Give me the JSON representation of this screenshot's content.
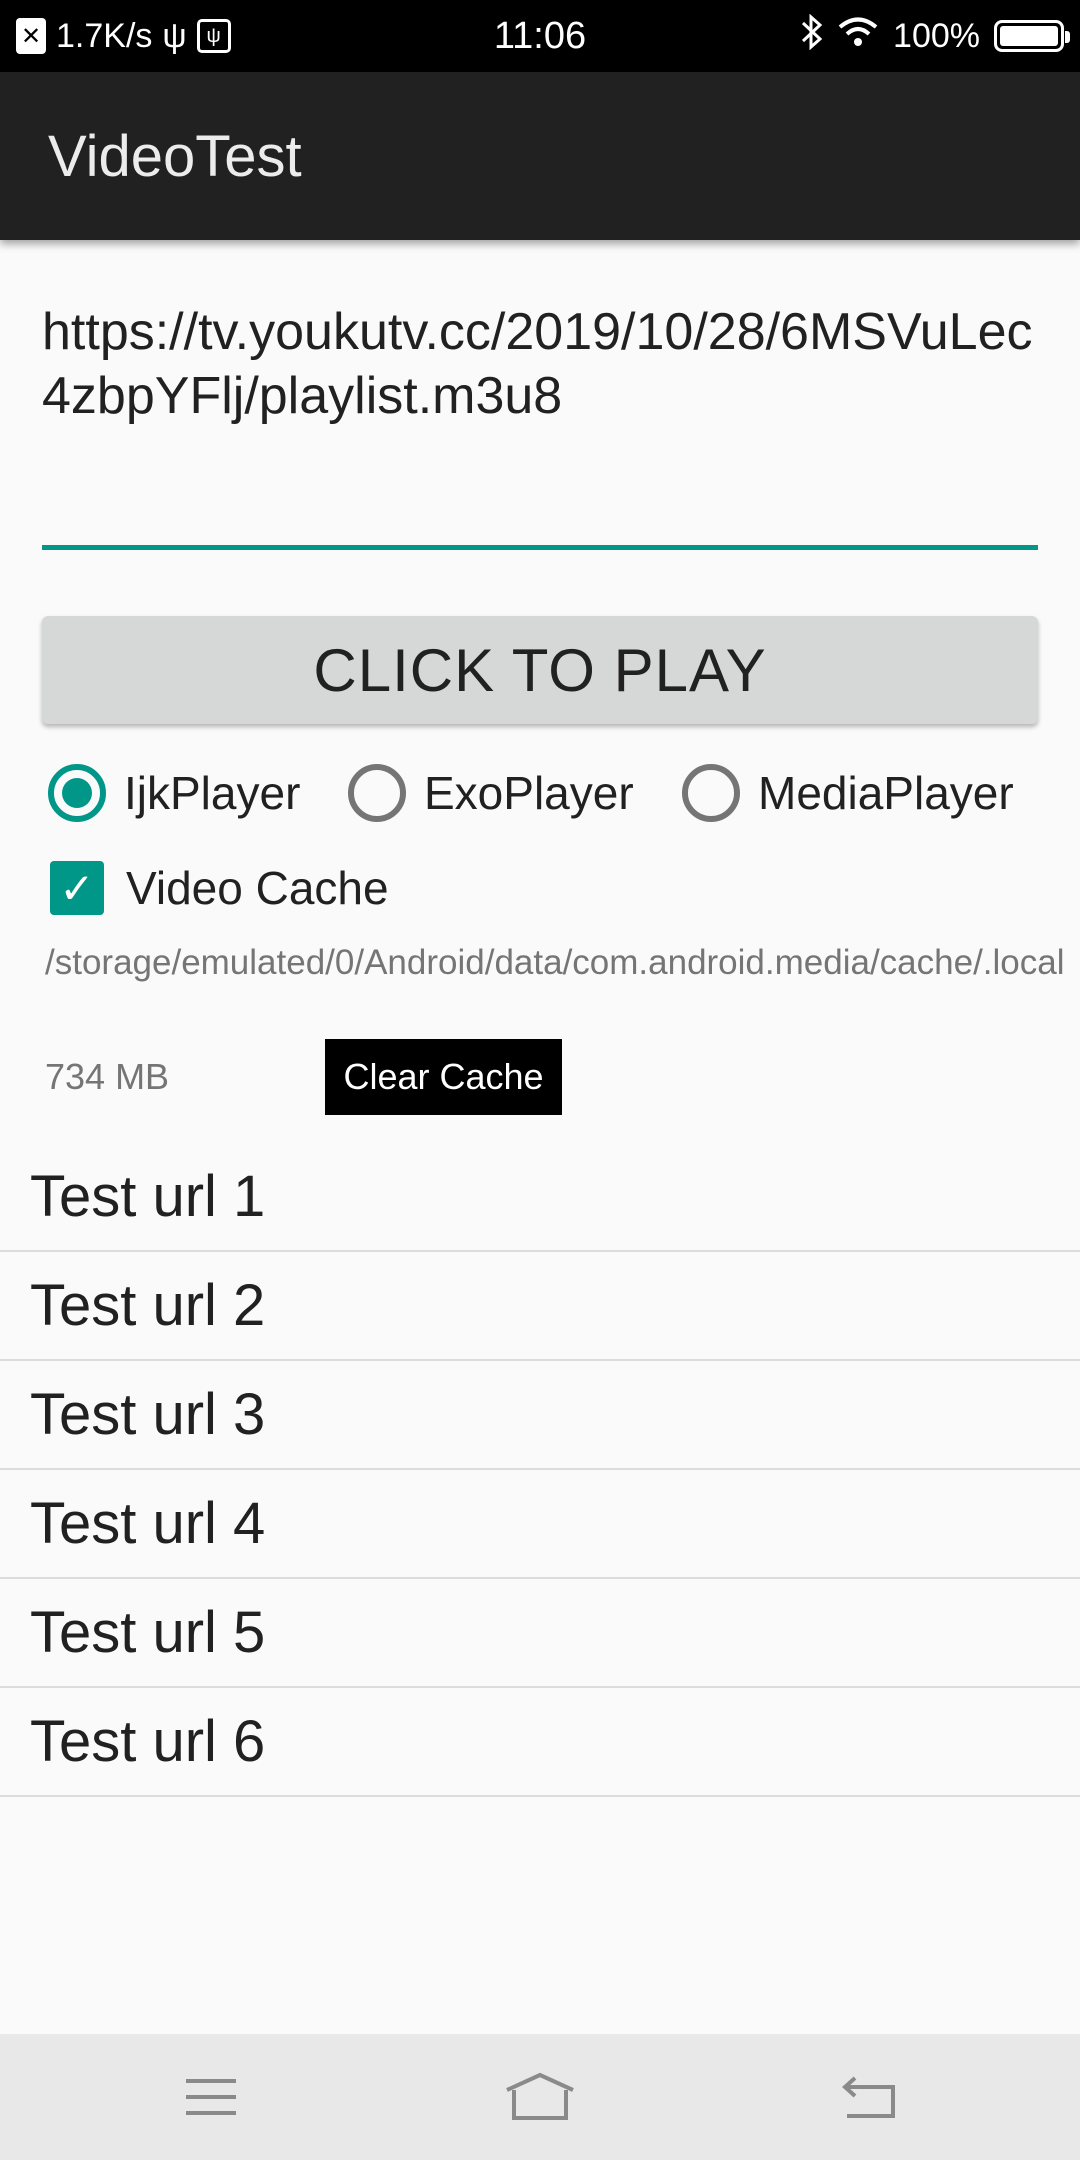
{
  "status_bar": {
    "net_speed": "1.7K/s",
    "time": "11:06",
    "battery": "100%",
    "battery_level": 1.0,
    "icons": [
      "close-icon",
      "usb-icon",
      "usb-debug-icon",
      "bluetooth-icon",
      "wifi-icon",
      "battery-icon"
    ]
  },
  "app_bar": {
    "title": "VideoTest"
  },
  "url_input": {
    "value": "https://tv.youkutv.cc/2019/10/28/6MSVuLec4zbpYFlj/playlist.m3u8"
  },
  "play_button": {
    "label": "CLICK TO PLAY"
  },
  "players": {
    "selected": "IjkPlayer",
    "options": [
      {
        "label": "IjkPlayer",
        "checked": true
      },
      {
        "label": "ExoPlayer",
        "checked": false
      },
      {
        "label": "MediaPlayer",
        "checked": false
      }
    ]
  },
  "video_cache": {
    "label": "Video Cache",
    "checked": true,
    "path": "/storage/emulated/0/Android/data/com.android.media/cache/.local",
    "size": "734 MB",
    "clear_label": "Clear Cache"
  },
  "test_urls": [
    "Test url 1",
    "Test url 2",
    "Test url 3",
    "Test url 4",
    "Test url 5",
    "Test url 6"
  ],
  "colors": {
    "accent": "#009688",
    "app_bar": "#212121",
    "status_bar": "#000000",
    "nav_bar": "#e8e8e8",
    "button": "#d6d7d7"
  },
  "nav_bar": {
    "icons": [
      "menu-icon",
      "home-icon",
      "back-icon"
    ]
  }
}
